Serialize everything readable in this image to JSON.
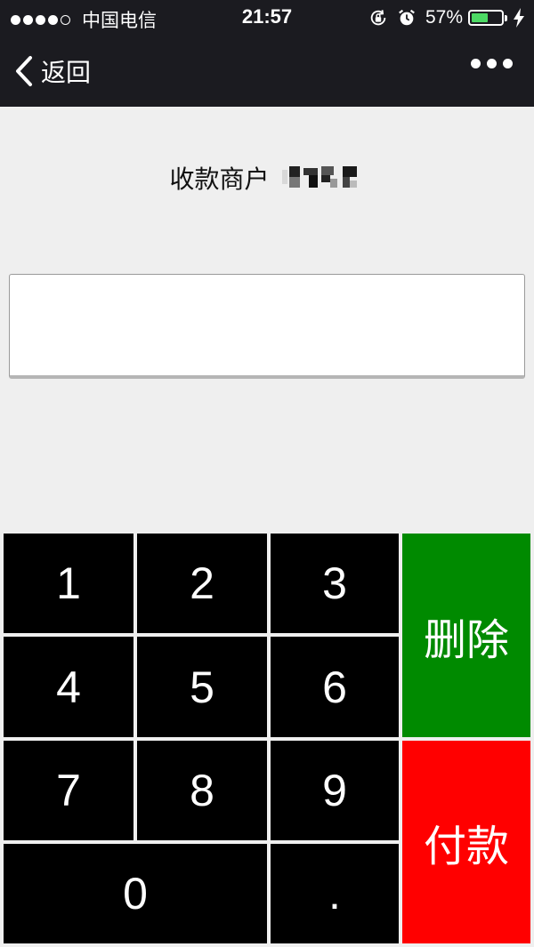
{
  "status_bar": {
    "carrier": "中国电信",
    "time": "21:57",
    "battery_percent": "57%",
    "battery_level": 0.57,
    "icons": [
      "signal-dots",
      "orientation-lock-icon",
      "alarm-icon",
      "battery-icon",
      "charging-icon"
    ]
  },
  "nav": {
    "back_label": "返回",
    "icons": [
      "chevron-left-icon",
      "more-icon"
    ]
  },
  "merchant": {
    "label": "收款商户"
  },
  "amount": {
    "value": "",
    "placeholder": ""
  },
  "keypad": {
    "k1": "1",
    "k2": "2",
    "k3": "3",
    "k4": "4",
    "k5": "5",
    "k6": "6",
    "k7": "7",
    "k8": "8",
    "k9": "9",
    "k0": "0",
    "dot": ".",
    "delete": "删除",
    "pay": "付款"
  },
  "colors": {
    "bar_background": "#1b1b20",
    "page_background": "#efefef",
    "key_background": "#000000",
    "delete_background": "#008a00",
    "pay_background": "#ff0000",
    "battery_fill": "#4cd964"
  }
}
